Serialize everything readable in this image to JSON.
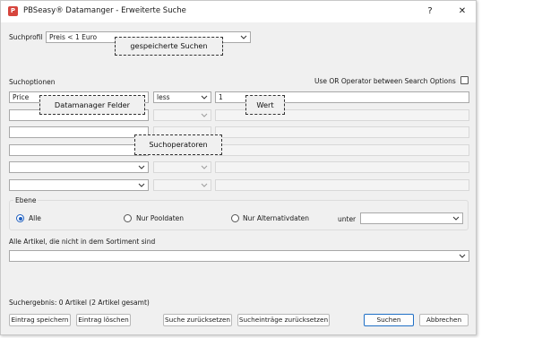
{
  "window": {
    "title": "PBSeasy® Datamanger - Erweiterte Suche",
    "help_label": "?",
    "close_label": "✕",
    "app_icon": "P"
  },
  "suchprofil": {
    "label": "Suchprofil",
    "value": "Preis < 1 Euro"
  },
  "suchoptionen": {
    "label": "Suchoptionen",
    "or_operator_label": "Use OR Operator between Search Options",
    "or_operator_checked": false,
    "rows": [
      {
        "field": "Price",
        "operator": "less",
        "value": "1"
      },
      {
        "field": "",
        "operator": "",
        "value": ""
      },
      {
        "field": "",
        "operator": "",
        "value": ""
      },
      {
        "field": "",
        "operator": "",
        "value": ""
      },
      {
        "field": "",
        "operator": "",
        "value": ""
      },
      {
        "field": "",
        "operator": "",
        "value": ""
      }
    ]
  },
  "ebene": {
    "label": "Ebene",
    "options": [
      "Alle",
      "Nur Pooldaten",
      "Nur Alternativdaten"
    ],
    "selected": "Alle",
    "unter_label": "unter",
    "unter_value": ""
  },
  "sortiment": {
    "label": "Alle Artikel, die nicht in dem Sortiment sind",
    "value": ""
  },
  "result": {
    "text": "Suchergebnis: 0 Artikel (2 Artikel gesamt)"
  },
  "buttons": {
    "save": "Eintrag speichern",
    "delete": "Eintrag löschen",
    "reset_search": "Suche zurücksetzen",
    "reset_entries": "Sucheinträge zurücksetzen",
    "search": "Suchen",
    "cancel": "Abbrechen"
  },
  "callouts": {
    "saved_searches": "gespeicherte Suchen",
    "fields": "Datamanager Felder",
    "value": "Wert",
    "operators": "Suchoperatoren"
  },
  "colors": {
    "accent": "#1f5fbf",
    "window_bg": "#f0f0f0",
    "titlebar_bg": "#ffffff"
  },
  "icons": {
    "app": "app-logo-icon",
    "dropdown": "chevron-down-icon"
  }
}
